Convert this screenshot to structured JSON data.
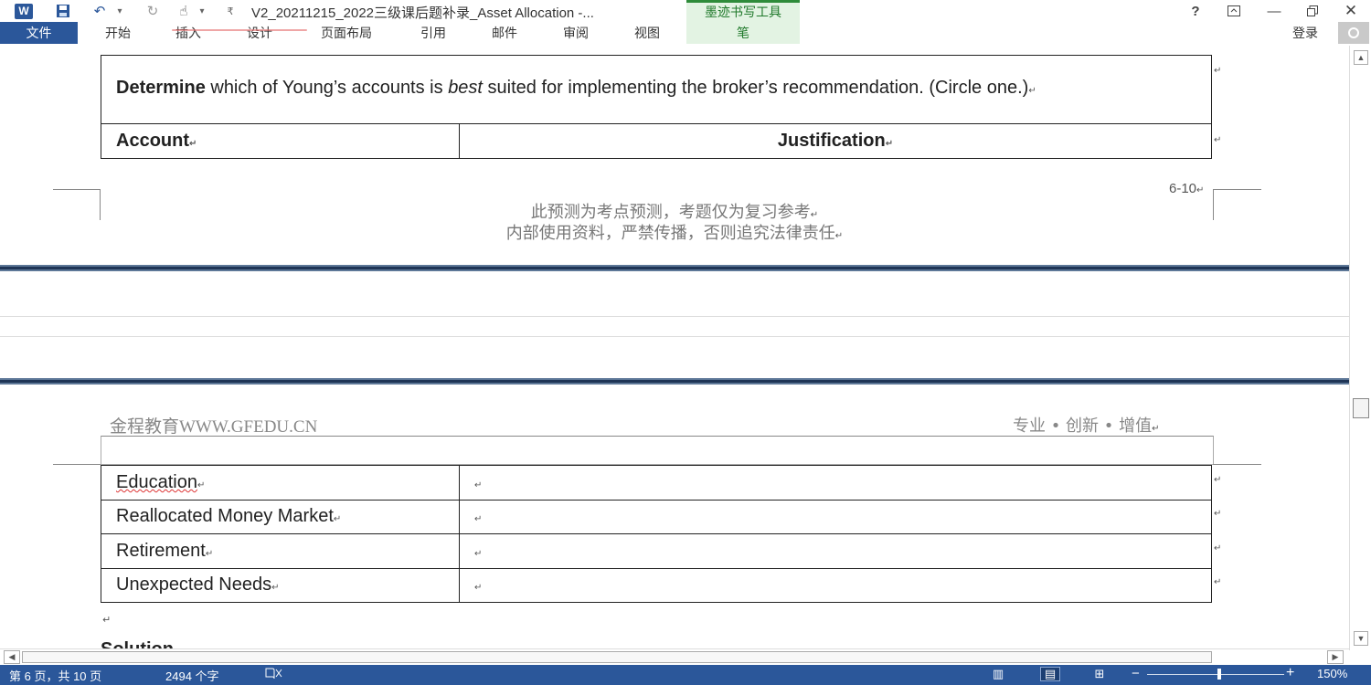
{
  "window": {
    "title": "V2_20211215_2022三级课后题补录_Asset Allocation -...",
    "contextual_group": "墨迹书写工具",
    "help": "?",
    "ribbon_display": "⊡",
    "minimize": "—",
    "restore": "🗗",
    "close": "✕"
  },
  "qat": {
    "word_icon": "W",
    "save": "💾",
    "undo": "↶",
    "redo": "↻",
    "touch": "☝",
    "dropdown": "▾",
    "customize": "₹"
  },
  "tabs": {
    "file": "文件",
    "home": "开始",
    "insert": "插入",
    "design": "设计",
    "layout": "页面布局",
    "references": "引用",
    "mailings": "邮件",
    "review": "审阅",
    "view": "视图",
    "pen": "笔"
  },
  "account": {
    "signin": "登录"
  },
  "document": {
    "question_bold": "Determine",
    "question_part1": " which of Young’s accounts is ",
    "question_italic": "best",
    "question_part2": " suited for implementing the broker’s recommendation. (Circle one.)",
    "para_mark": "↵",
    "header_account": "Account",
    "header_justification": "Justification",
    "page_number": "6-10",
    "footer_line1": "此预测为考点预测，考题仅为复习参考",
    "footer_line2": "内部使用资料，严禁传播，否则追究法律责任",
    "next_header_left": "金程教育WWW.GFEDU.CN",
    "next_header_right": "专业 • 创新 • 增值",
    "rows": [
      {
        "account": "Education",
        "justification": ""
      },
      {
        "account": "Reallocated Money Market",
        "justification": ""
      },
      {
        "account": "Retirement",
        "justification": ""
      },
      {
        "account": "Unexpected Needs",
        "justification": ""
      }
    ],
    "solution_peek": "Solution"
  },
  "scrollbars": {
    "up": "▲",
    "down": "▼",
    "left": "◀",
    "right": "▶"
  },
  "statusbar": {
    "page_info": "第 6 页，共 10 页",
    "word_count": "2494 个字",
    "proofing_icon": "📖",
    "read_mode_icon": "▥",
    "print_layout_icon": "▤",
    "web_layout_icon": "⊞",
    "zoom_minus": "−",
    "zoom_plus": "+",
    "zoom": "150%",
    "zoom_fraction": 0.5
  },
  "colors": {
    "accent": "#2b579a",
    "pen_tab_bg": "#e3f3e3",
    "pen_tab_text": "#217a2c",
    "page_break": "#1f3556"
  }
}
